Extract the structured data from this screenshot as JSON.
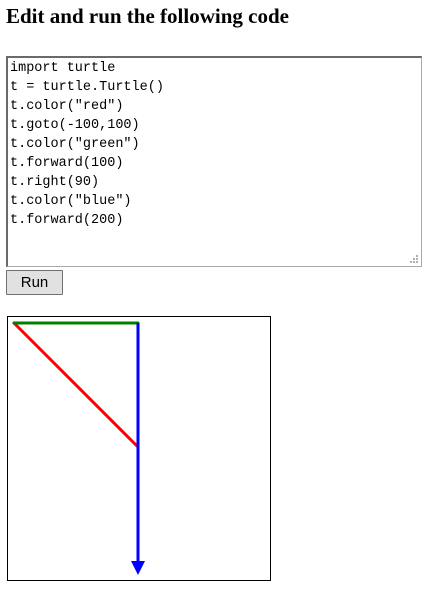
{
  "page": {
    "title": "Edit and run the following code"
  },
  "editor": {
    "lines": [
      "import turtle",
      "t = turtle.Turtle()",
      "t.color(\"red\")",
      "t.goto(-100,100)",
      "t.color(\"green\")",
      "t.forward(100)",
      "t.right(90)",
      "t.color(\"blue\")",
      "t.forward(200)"
    ]
  },
  "run_button": {
    "label": "Run"
  },
  "canvas": {
    "colors": {
      "red": "#ff0000",
      "green": "#008000",
      "blue": "#0000ff"
    }
  }
}
